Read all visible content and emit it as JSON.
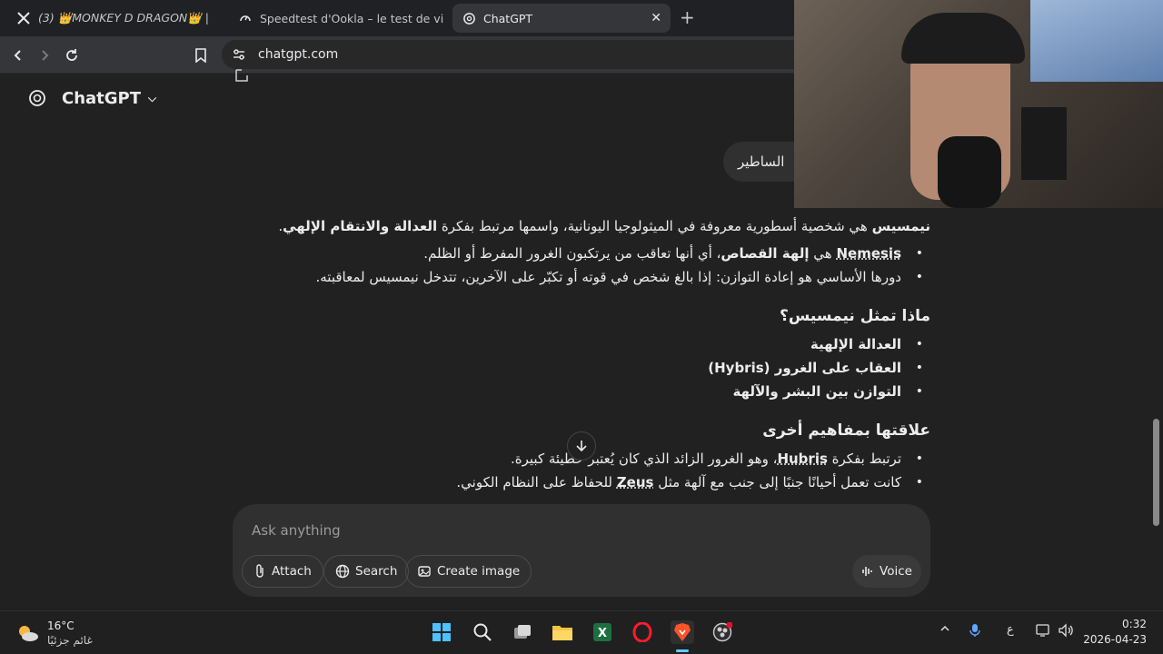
{
  "browser": {
    "tabs": [
      {
        "label": "(3) 👑MONKEY D DRAGON👑 |",
        "icon": "x-logo-icon",
        "active": false
      },
      {
        "label": "Speedtest d'Ookla – le test de vitesse",
        "icon": "speedtest-icon",
        "active": false
      },
      {
        "label": "ChatGPT",
        "icon": "chatgpt-icon",
        "active": true
      }
    ],
    "url": "chatgpt.com"
  },
  "app": {
    "brand": "ChatGPT",
    "user_message": "الساطير",
    "answer": {
      "intro_bold": "نيمسيس",
      "intro_text": " هي شخصية أسطورية معروفة في الميثولوجيا اليونانية، واسمها مرتبط بفكرة ",
      "intro_bold2": "العدالة والانتقام الإلهي",
      "intro_end": ".",
      "bullets1": [
        {
          "term": "Nemesis",
          "mid": " هي ",
          "bold": "إلهة القصاص",
          "rest": "، أي أنها تعاقب من يرتكبون الغرور المفرط أو الظلم."
        },
        {
          "text": "دورها الأساسي هو إعادة التوازن: إذا بالغ شخص في قوته أو تكبّر على الآخرين، تتدخل نيمسيس لمعاقبته."
        }
      ],
      "heading2": "ماذا تمثل نيمسيس؟",
      "bullets2": [
        "العدالة الإلهية",
        "العقاب على الغرور (Hybris)",
        "التوازن بين البشر والآلهة"
      ],
      "heading3": "علاقتها بمفاهيم أخرى",
      "bullets3": [
        {
          "pre": "ترتبط بفكرة ",
          "term": "Hubris",
          "rest": "، وهو الغرور الزائد الذي كان يُعتبر خطيئة كبيرة."
        },
        {
          "pre": "كانت تعمل أحيانًا جنبًا إلى جنب مع آلهة مثل ",
          "term": "Zeus",
          "rest": " للحفاظ على النظام الكوني."
        }
      ]
    },
    "composer": {
      "placeholder": "Ask anything",
      "attach": "Attach",
      "search": "Search",
      "create_image": "Create image",
      "voice": "Voice"
    }
  },
  "taskbar": {
    "temperature": "16°C",
    "weather_desc": "غائم جزئيًا",
    "lang": "ع",
    "time": "0:32",
    "date": "2026-04-23"
  },
  "colors": {
    "background": "#212121",
    "composer": "#303030",
    "brave": "#fb542b",
    "excel": "#1d6f42"
  }
}
